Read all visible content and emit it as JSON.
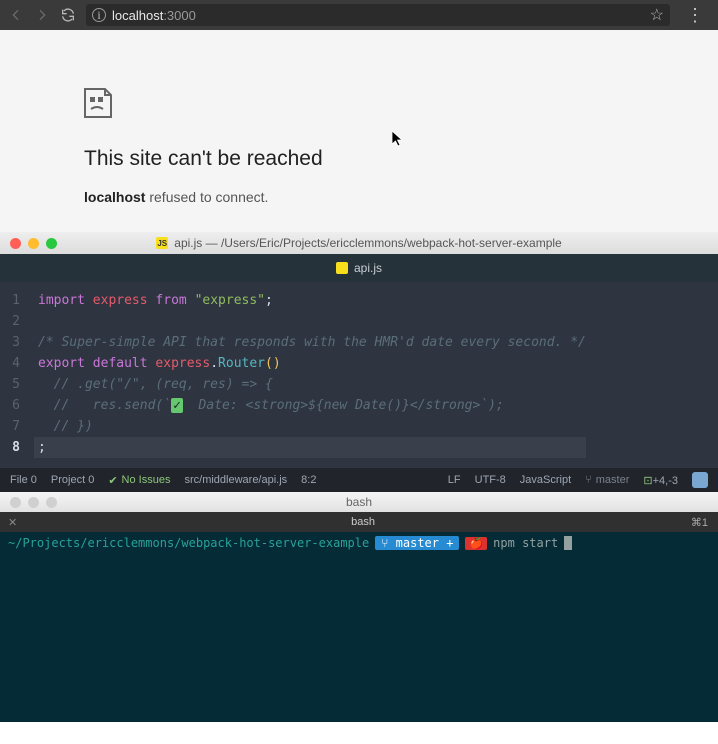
{
  "browser": {
    "url_display": "localhost:3000",
    "url_prefix": "localhost",
    "url_suffix": ":3000"
  },
  "error": {
    "title": "This site can't be reached",
    "host": "localhost",
    "message": " refused to connect."
  },
  "editor": {
    "window_title": "api.js — /Users/Eric/Projects/ericclemmons/webpack-hot-server-example",
    "tab_name": "api.js",
    "gutter": [
      "1",
      "2",
      "3",
      "4",
      "5",
      "6",
      "7",
      "8"
    ],
    "active_line_index": 7,
    "code": {
      "l1_import": "import",
      "l1_express": "express",
      "l1_from": "from",
      "l1_str": "\"express\"",
      "l1_semi": ";",
      "l3_cmt": "/* Super-simple API that responds with the HMR'd date every second. */",
      "l4_export": "export",
      "l4_default": "default",
      "l4_express": "express",
      "l4_dot": ".",
      "l4_router": "Router",
      "l4_parens": "()",
      "l5_cmt": "  // .get(\"/\", (req, res) => {",
      "l6_cmt_a": "  //   res.send(`",
      "l6_check": "✓",
      "l6_cmt_b": "  Date: <strong>${new Date()}</strong>`);",
      "l7_cmt": "  // })",
      "l8_text": ";"
    }
  },
  "status": {
    "file_count": "File 0",
    "project_count": "Project 0",
    "no_issues": "No Issues",
    "path": "src/middleware/api.js",
    "pos": "8:2",
    "eol": "LF",
    "encoding": "UTF-8",
    "language": "JavaScript",
    "branch": "master",
    "diff": "+4,-3"
  },
  "terminal": {
    "title": "bash",
    "tab": "bash",
    "shortcut": "⌘1",
    "cwd": "~/Projects/ericclemmons/webpack-hot-server-example",
    "branch_label": "⑂ master +",
    "sep_icon": "🍎",
    "cmd": "npm start"
  }
}
